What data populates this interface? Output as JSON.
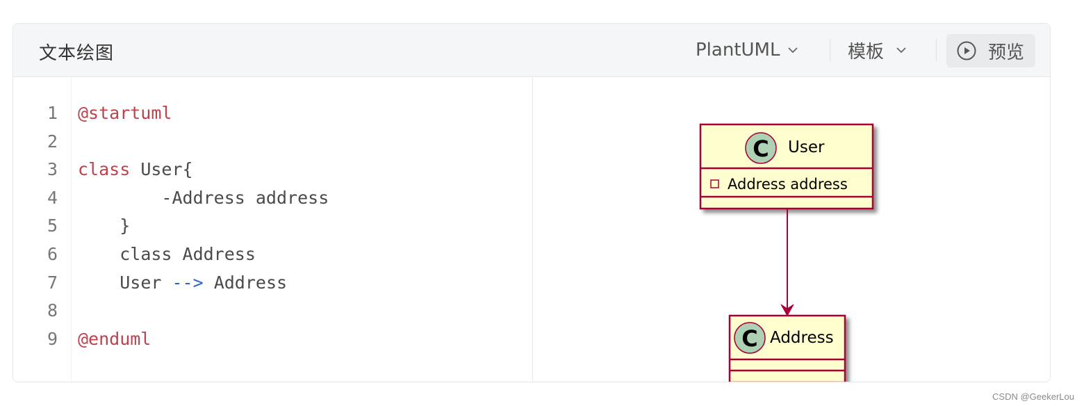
{
  "toolbar": {
    "title": "文本绘图",
    "language_label": "PlantUML",
    "template_label": "模板",
    "preview_label": "预览"
  },
  "editor": {
    "line_numbers": [
      "1",
      "2",
      "3",
      "4",
      "5",
      "6",
      "7",
      "8",
      "9"
    ],
    "lines": [
      {
        "indent": "",
        "parts": [
          {
            "t": "@startuml",
            "c": "kw"
          }
        ]
      },
      {
        "indent": "",
        "parts": []
      },
      {
        "indent": "",
        "parts": [
          {
            "t": "class",
            "c": "kw"
          },
          {
            "t": " User{",
            "c": ""
          }
        ]
      },
      {
        "indent": "        ",
        "parts": [
          {
            "t": "-Address address",
            "c": ""
          }
        ]
      },
      {
        "indent": "    ",
        "parts": [
          {
            "t": "}",
            "c": ""
          }
        ]
      },
      {
        "indent": "    ",
        "parts": [
          {
            "t": "class Address",
            "c": ""
          }
        ]
      },
      {
        "indent": "    ",
        "parts": [
          {
            "t": "User ",
            "c": ""
          },
          {
            "t": "-->",
            "c": "arrow-op"
          },
          {
            "t": " Address",
            "c": ""
          }
        ]
      },
      {
        "indent": "",
        "parts": []
      },
      {
        "indent": "",
        "parts": [
          {
            "t": "@enduml",
            "c": "kw"
          }
        ]
      }
    ]
  },
  "diagram": {
    "class_user": {
      "name": "User",
      "stereotype_letter": "C",
      "field": "Address address"
    },
    "class_address": {
      "name": "Address",
      "stereotype_letter": "C"
    },
    "colors": {
      "fill": "#fefece",
      "border": "#a80036",
      "circle": "#add1b2",
      "arrow": "#a80036"
    }
  },
  "watermark": "CSDN @GeekerLou"
}
